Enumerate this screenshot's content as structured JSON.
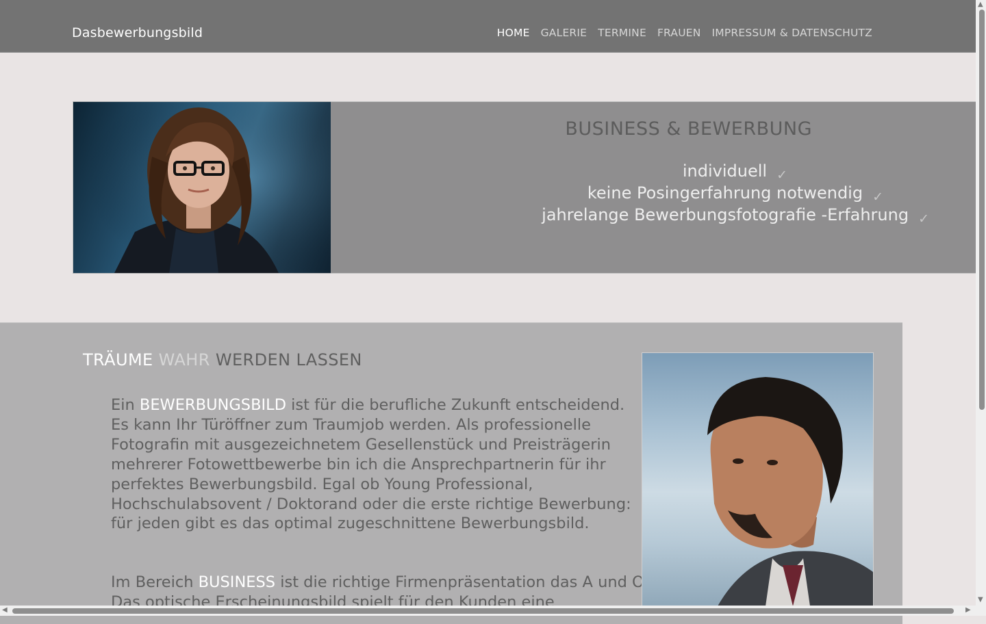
{
  "header": {
    "brand": "Dasbewerbungsbild",
    "nav": [
      {
        "label": "HOME",
        "active": true
      },
      {
        "label": "GALERIE",
        "active": false
      },
      {
        "label": "TERMINE",
        "active": false
      },
      {
        "label": "FRAUEN",
        "active": false
      },
      {
        "label": "IMPRESSUM & DATENSCHUTZ",
        "active": false
      }
    ]
  },
  "hero": {
    "title": "BUSINESS & BEWERBUNG",
    "bullets": [
      {
        "text": "individuell",
        "check": "✓"
      },
      {
        "text": "keine Posingerfahrung notwendig",
        "check": "✓"
      },
      {
        "text": "jahrelange Bewerbungsfotografie -Erfahrung",
        "check": "✓"
      }
    ]
  },
  "content": {
    "title_part1": "TRÄUME",
    "title_part2": "WAHR",
    "title_part3": "WERDEN LASSEN",
    "p1_before": "Ein ",
    "p1_highlight": "BEWERBUNGSBILD",
    "p1_after": " ist für die berufliche Zukunft entscheidend. Es kann Ihr Türöffner zum Traumjob werden. Als professionelle Fotografin mit ausgezeichnetem Gesellenstück und Preisträgerin mehrerer Fotowettbewerbe bin ich die Ansprechpartnerin für ihr perfektes Bewerbungsbild. Egal ob Young Professional, Hochschulabsovent / Doktorand oder die erste richtige Bewerbung: für jeden gibt es das optimal zugeschnittene Bewerbungsbild.",
    "p2_before": "Im Bereich ",
    "p2_highlight": "BUSINESS",
    "p2_after": " ist die richtige Firmenpräsentation das A und O. Das optische Erscheinungsbild spielt für den Kunden eine"
  },
  "colors": {
    "header_bg": "#737373",
    "page_bg": "#e9e4e4",
    "hero_panel": "#8f8e8f",
    "content_bg": "#b1b0b1"
  }
}
